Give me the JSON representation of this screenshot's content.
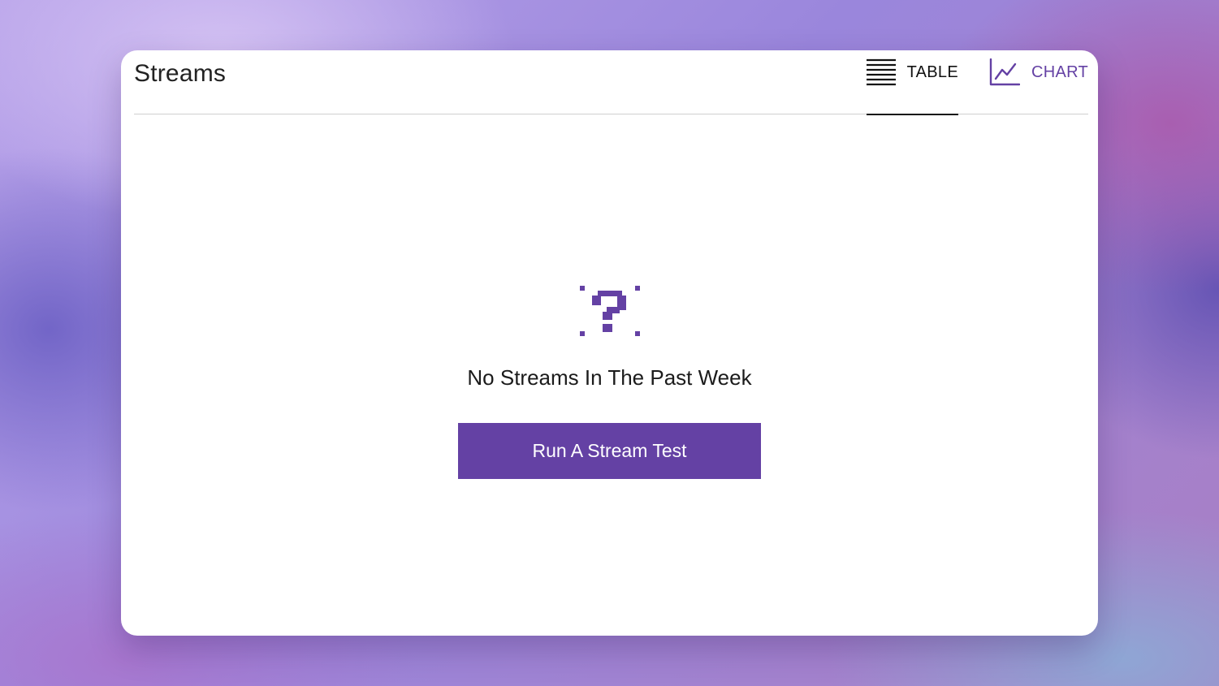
{
  "header": {
    "title": "Streams",
    "tabs": [
      {
        "label": "TABLE",
        "icon": "table-icon",
        "selected": true
      },
      {
        "label": "CHART",
        "icon": "line-chart-icon",
        "selected": false
      }
    ]
  },
  "empty_state": {
    "icon": "question-mark-icon",
    "message": "No Streams In The Past Week",
    "button_label": "Run A Stream Test"
  },
  "colors": {
    "accent": "#6441a4",
    "text": "#222222",
    "card_background": "#ffffff"
  }
}
